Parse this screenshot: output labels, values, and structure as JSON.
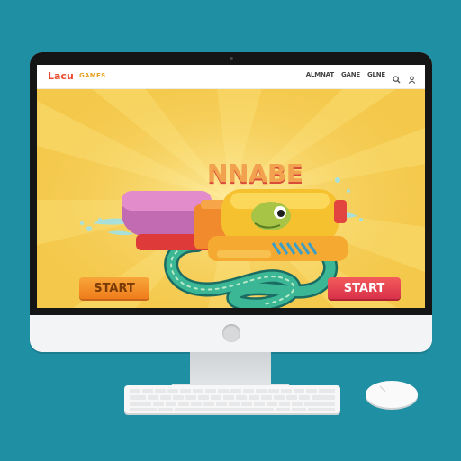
{
  "header": {
    "brand": "Lacu",
    "brand_sub": "GAMES",
    "nav_links": [
      "ALMNAT",
      "GANE",
      "GLNE"
    ],
    "icons": [
      "search-icon",
      "user-icon"
    ]
  },
  "hero": {
    "title": "NNABE"
  },
  "buttons": {
    "start_left": "START",
    "start_right": "START"
  },
  "colors": {
    "background": "#1f8fa3",
    "screen_bg": "#f4c84a",
    "start_left": "#ef7c1b",
    "start_right": "#d8324b",
    "brand": "#ea4a2f"
  }
}
